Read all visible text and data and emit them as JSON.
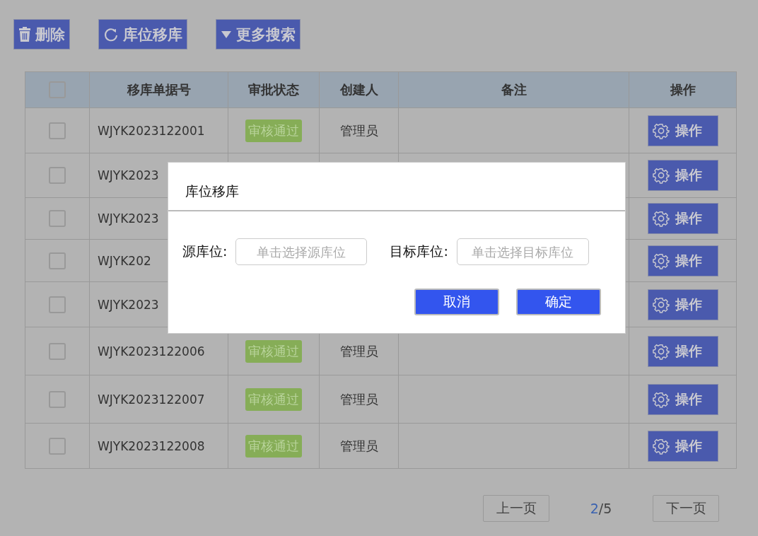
{
  "toolbar": [
    {
      "kind": "trash",
      "label": "删除"
    },
    {
      "kind": "refresh",
      "label": "库位移库"
    },
    {
      "kind": "caret",
      "label": "更多搜索"
    }
  ],
  "table": {
    "select_all": {
      "checked": false
    },
    "columns": [
      "移库单据号",
      "审批状态",
      "创建人",
      "备注",
      "操作"
    ],
    "rows": [
      {
        "checked": false,
        "id": "WJYK2023122001",
        "status": "审核通过",
        "creator": "管理员",
        "action": "操作"
      },
      {
        "checked": false,
        "id": "WJYK2023",
        "action": "操作"
      },
      {
        "checked": false,
        "id": "WJYK2023",
        "action": "操作"
      },
      {
        "checked": false,
        "id": "WJYK202",
        "action": "操作"
      },
      {
        "checked": false,
        "id": "WJYK2023",
        "action": "操作"
      },
      {
        "checked": false,
        "id": "WJYK2023122006",
        "status": "审核通过",
        "creator": "管理员",
        "action": "操作"
      },
      {
        "checked": false,
        "id": "WJYK2023122007",
        "status": "审核通过",
        "creator": "管理员",
        "action": "操作"
      },
      {
        "checked": false,
        "id": "WJYK2023122008",
        "status": "审核通过",
        "creator": "管理员",
        "action": "操作"
      }
    ]
  },
  "pagination": {
    "prev": "上一页",
    "current": "2",
    "total": "/5",
    "next": "下一页"
  },
  "dialog": {
    "title": "库位移库",
    "fields": [
      {
        "label": "源库位:",
        "placeholder": "单击选择源库位"
      },
      {
        "label": "目标库位:",
        "placeholder": "单击选择目标库位"
      }
    ],
    "buttons": [
      "取消",
      "确定"
    ]
  }
}
